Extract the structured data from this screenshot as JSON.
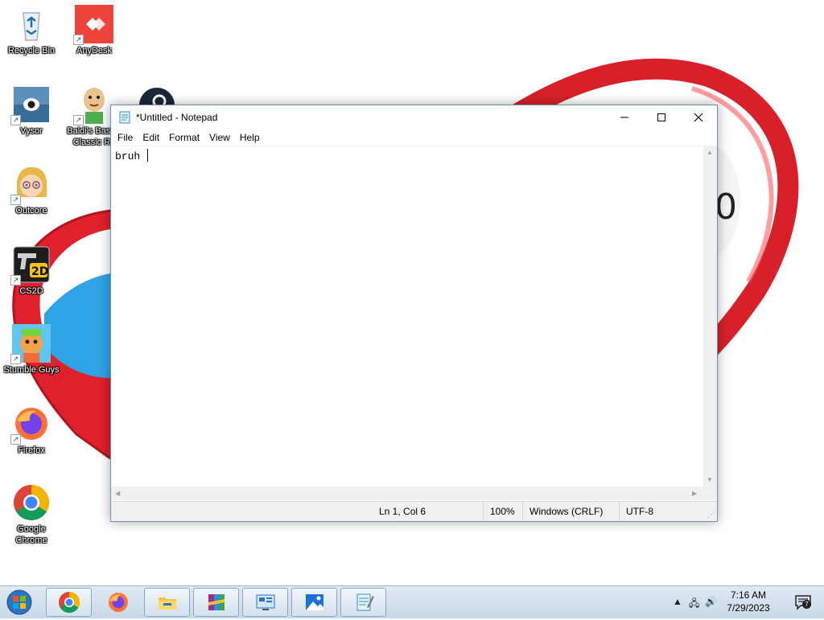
{
  "desktop": {
    "icons": [
      {
        "label": "Recycle Bin"
      },
      {
        "label": "AnyDesk"
      },
      {
        "label": "Vysor"
      },
      {
        "label": "Baldi's Basics Classic Re"
      },
      {
        "label": "Outcore"
      },
      {
        "label": "CS2D"
      },
      {
        "label": "Stumble Guys"
      },
      {
        "label": "Firefox"
      },
      {
        "label": "Google Chrome"
      }
    ]
  },
  "notepad": {
    "title": "*Untitled - Notepad",
    "menu": [
      "File",
      "Edit",
      "Format",
      "View",
      "Help"
    ],
    "content": "bruh ",
    "status": {
      "position": "Ln 1, Col 6",
      "zoom": "100%",
      "line_ending": "Windows (CRLF)",
      "encoding": "UTF-8"
    }
  },
  "taskbar": {
    "apps": [
      "chrome-icon",
      "firefox-icon",
      "file-explorer-icon",
      "winrar-icon",
      "control-panel-icon",
      "photos-icon",
      "notepad-icon"
    ],
    "clock": {
      "time": "7:16 AM",
      "date": "7/29/2023"
    },
    "notification_count": "7"
  },
  "colors": {
    "heart_red": "#e0202c",
    "taskbar_bg": "#d3e0ee",
    "window_border": "#6f8fb5"
  }
}
